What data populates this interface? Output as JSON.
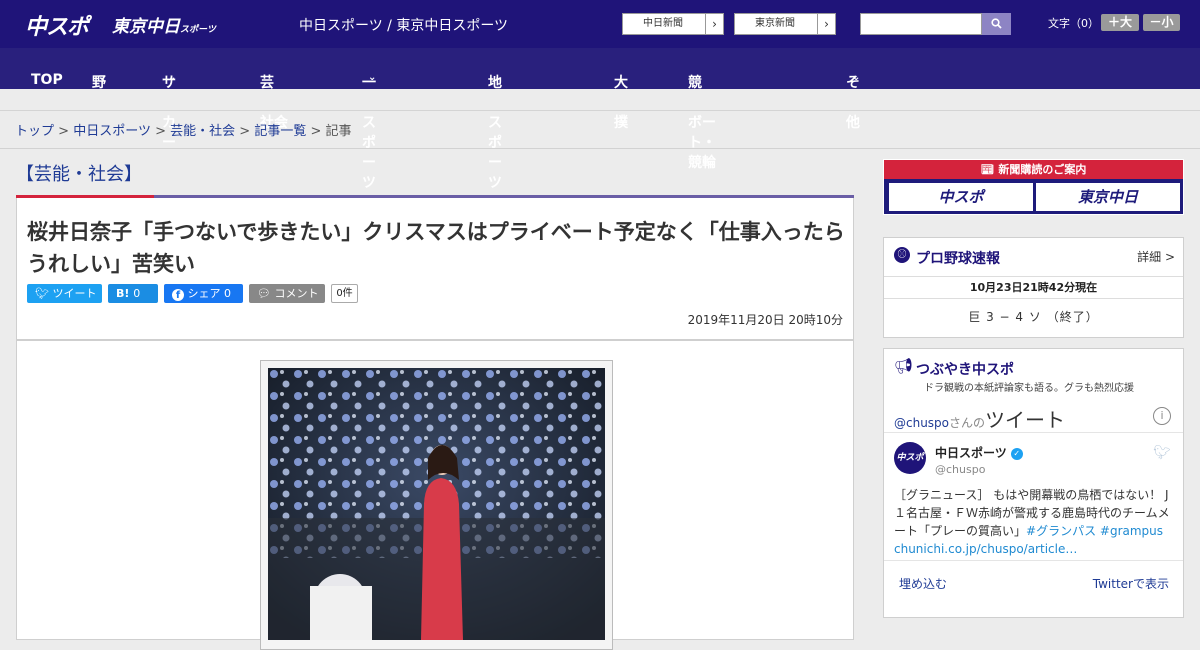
{
  "header": {
    "logo_main": "中スポ",
    "logo_tokyo": "東京中日",
    "logo_tokyo_small": "スポーツ",
    "site_name": "中日スポーツ / 東京中日スポーツ",
    "ext_links": [
      "中日新聞",
      "東京新聞"
    ],
    "ext_arrow": "›",
    "search_placeholder": "",
    "font_size_label": "文字（0）",
    "font_plus": "＋大",
    "font_minus": "－小"
  },
  "nav": {
    "items": [
      {
        "label": "TOP",
        "dropdown": false
      },
      {
        "label": "野球",
        "dropdown": true
      },
      {
        "label": "サッカー",
        "dropdown": true
      },
      {
        "label": "芸能・社会",
        "dropdown": false
      },
      {
        "label": "一般スポーツ",
        "dropdown": true
      },
      {
        "label": "地域スポーツ",
        "dropdown": true
      },
      {
        "label": "大相撲",
        "dropdown": false
      },
      {
        "label": "競馬・ボート・競輪",
        "dropdown": false
      },
      {
        "label": "その他",
        "dropdown": true
      }
    ],
    "dropdown_glyph": "⌄"
  },
  "breadcrumb": {
    "items": [
      "トップ",
      "中日スポーツ",
      "芸能・社会",
      "記事一覧"
    ],
    "current": "記事",
    "separator": ">"
  },
  "article": {
    "category": "【芸能・社会】",
    "title": "桜井日奈子「手つないで歩きたい」クリスマスはプライベート予定なく「仕事入ったらうれしい」苦笑い",
    "share": {
      "tweet": "ツイート",
      "hatena_label": "B!",
      "hatena_count": "0",
      "facebook_label": "シェア",
      "facebook_count": "0",
      "comment": "コメント",
      "comment_count": "0件"
    },
    "date": "2019年11月20日 20時10分"
  },
  "sidebar": {
    "subscribe": {
      "head": "新聞購読のご案内",
      "chuspo": "中スポ",
      "tokyo": "東京中日"
    },
    "baseball": {
      "title": "プロ野球速報",
      "detail": "詳細 >",
      "as_of": "10月23日21時42分現在",
      "score": "巨 3 − 4 ソ （終了）"
    },
    "tweets": {
      "title": "つぶやき中スポ",
      "subtitle": "ドラ観戦の本紙評論家も語る。グラも熱烈応援",
      "handle_link": "@chuspo",
      "handle_suffix": "さんの",
      "heading": "ツイート",
      "info": "i",
      "account_name": "中日スポーツ",
      "account_handle": "@chuspo",
      "avatar_text": "中スポ",
      "text": "［グラニュース］ もはや開幕戦の鳥栖ではない！ J１名古屋・ＦＷ赤崎が警戒する鹿島時代のチームメート「プレーの質高い」",
      "tag1": "#グランパス",
      "tag2": "#grampus",
      "link": "chunichi.co.jp/chuspo/article…",
      "embed": "埋め込む",
      "view": "Twitterで表示"
    }
  }
}
